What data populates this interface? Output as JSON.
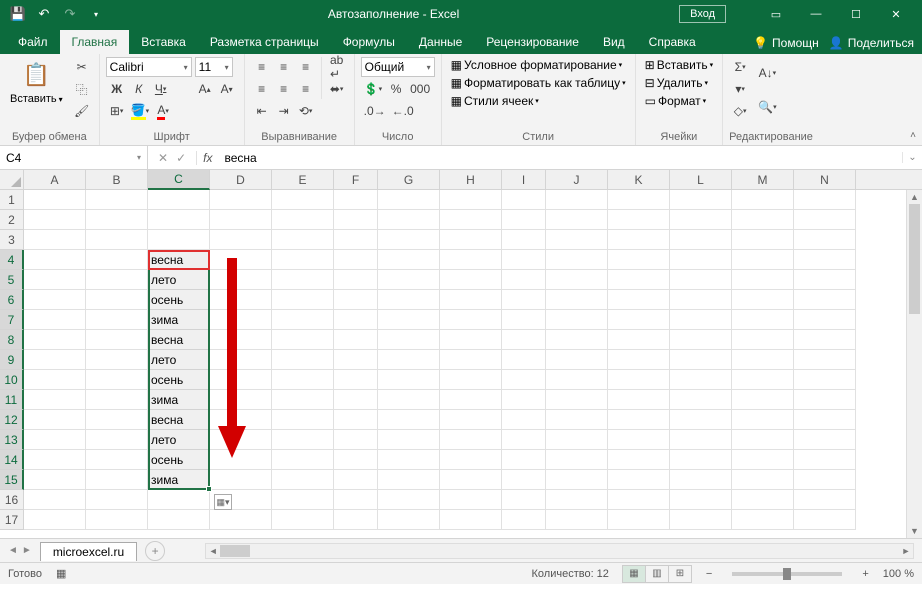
{
  "title": "Автозаполнение  -  Excel",
  "login_btn": "Вход",
  "tabs": {
    "file": "Файл",
    "home": "Главная",
    "insert": "Вставка",
    "layout": "Разметка страницы",
    "formulas": "Формулы",
    "data": "Данные",
    "review": "Рецензирование",
    "view": "Вид",
    "help": "Справка",
    "helper": "Помощн",
    "share": "Поделиться"
  },
  "ribbon": {
    "clipboard": {
      "paste": "Вставить",
      "label": "Буфер обмена"
    },
    "font": {
      "name": "Calibri",
      "size": "11",
      "label": "Шрифт",
      "bold": "Ж",
      "italic": "К",
      "underline": "Ч"
    },
    "alignment": {
      "label": "Выравнивание"
    },
    "number": {
      "format": "Общий",
      "label": "Число"
    },
    "styles": {
      "cond": "Условное форматирование",
      "table": "Форматировать как таблицу",
      "cell": "Стили ячеек",
      "label": "Стили"
    },
    "cells": {
      "insert": "Вставить",
      "delete": "Удалить",
      "format": "Формат",
      "label": "Ячейки"
    },
    "editing": {
      "label": "Редактирование"
    }
  },
  "namebox": "C4",
  "formula": "весна",
  "columns": [
    "A",
    "B",
    "C",
    "D",
    "E",
    "F",
    "G",
    "H",
    "I",
    "J",
    "K",
    "L",
    "M",
    "N"
  ],
  "col_widths": [
    "colA",
    "colB",
    "colC",
    "colD",
    "colE",
    "colF",
    "colG",
    "colH",
    "colI",
    "colJ",
    "colK",
    "colL",
    "colM",
    "colN"
  ],
  "selected_col_idx": 2,
  "rows": 17,
  "selected_rows": [
    4,
    5,
    6,
    7,
    8,
    9,
    10,
    11,
    12,
    13,
    14,
    15
  ],
  "cell_data": {
    "C4": "весна",
    "C5": "лето",
    "C6": "осень",
    "C7": "зима",
    "C8": "весна",
    "C9": "лето",
    "C10": "осень",
    "C11": "зима",
    "C12": "весна",
    "C13": "лето",
    "C14": "осень",
    "C15": "зима"
  },
  "sheet_tab": "microexcel.ru",
  "status": {
    "ready": "Готово",
    "count_label": "Количество: 12",
    "zoom": "100 %"
  }
}
